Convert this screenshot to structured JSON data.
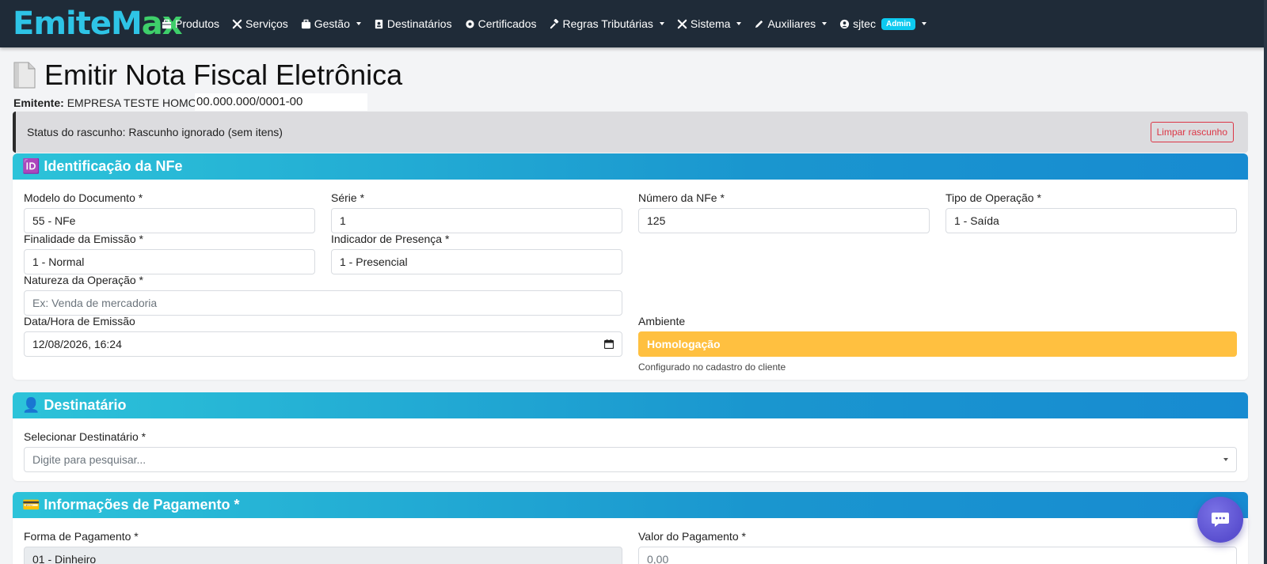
{
  "brand": {
    "part1": "EmiteM",
    "part2": "ax"
  },
  "nav": {
    "items": [
      {
        "label": "Produtos",
        "icon": "box-icon",
        "dropdown": false
      },
      {
        "label": "Serviços",
        "icon": "tools-icon",
        "dropdown": false
      },
      {
        "label": "Gestão",
        "icon": "briefcase-icon",
        "dropdown": true
      },
      {
        "label": "Destinatários",
        "icon": "address-book-icon",
        "dropdown": false
      },
      {
        "label": "Certificados",
        "icon": "certificate-icon",
        "dropdown": false
      },
      {
        "label": "Regras Tributárias",
        "icon": "gavel-icon",
        "dropdown": true
      },
      {
        "label": "Sistema",
        "icon": "tools-icon",
        "dropdown": true
      },
      {
        "label": "Auxiliares",
        "icon": "pencil-icon",
        "dropdown": true
      }
    ],
    "user": {
      "name": "sjtec",
      "badge": "Admin",
      "icon": "user-circle-icon"
    }
  },
  "page": {
    "title": "Emitir Nota Fiscal Eletrônica",
    "title_icon": "document-icon",
    "emitente_label": "Emitente:",
    "emitente_name": "EMPRESA TESTE HOMOLO",
    "emitente_cnpj": "00.000.000/0001-00"
  },
  "draft": {
    "status": "Status do rascunho: Rascunho ignorado (sem itens)",
    "clear_button": "Limpar rascunho"
  },
  "identificacao": {
    "header_icon": "🆔",
    "header": "Identificação da NFe",
    "modelo": {
      "label": "Modelo do Documento *",
      "value": "55 - NFe"
    },
    "serie": {
      "label": "Série *",
      "value": "1"
    },
    "numero": {
      "label": "Número da NFe *",
      "value": "125"
    },
    "tipo_operacao": {
      "label": "Tipo de Operação *",
      "value": "1 - Saída"
    },
    "finalidade": {
      "label": "Finalidade da Emissão *",
      "value": "1 - Normal"
    },
    "presenca": {
      "label": "Indicador de Presença *",
      "value": "1 - Presencial"
    },
    "natureza": {
      "label": "Natureza da Operação *",
      "placeholder": "Ex: Venda de mercadoria"
    },
    "data_emissao": {
      "label": "Data/Hora de Emissão",
      "value": "12/08/2026, 16:24"
    },
    "ambiente": {
      "label": "Ambiente",
      "value": "Homologação",
      "hint": "Configurado no cadastro do cliente"
    }
  },
  "destinatario": {
    "header_icon": "👤",
    "header": "Destinatário",
    "select": {
      "label": "Selecionar Destinatário *",
      "placeholder": "Digite para pesquisar..."
    }
  },
  "pagamento": {
    "header_icon": "💳",
    "header": "Informações de Pagamento *",
    "forma": {
      "label": "Forma de Pagamento *",
      "value": "01 - Dinheiro"
    },
    "valor": {
      "label": "Valor do Pagamento *",
      "value": "0,00"
    }
  },
  "colors": {
    "navbar": "#1f2b38",
    "brand_blue": "#2ec4e6",
    "brand_green": "#3ecf6a",
    "header_gradient_start": "#2cc3d9",
    "header_gradient_end": "#178bd1",
    "ambiente_warning": "#ffc040",
    "danger": "#dc3545",
    "chat_fab": "#5a4fcf"
  }
}
